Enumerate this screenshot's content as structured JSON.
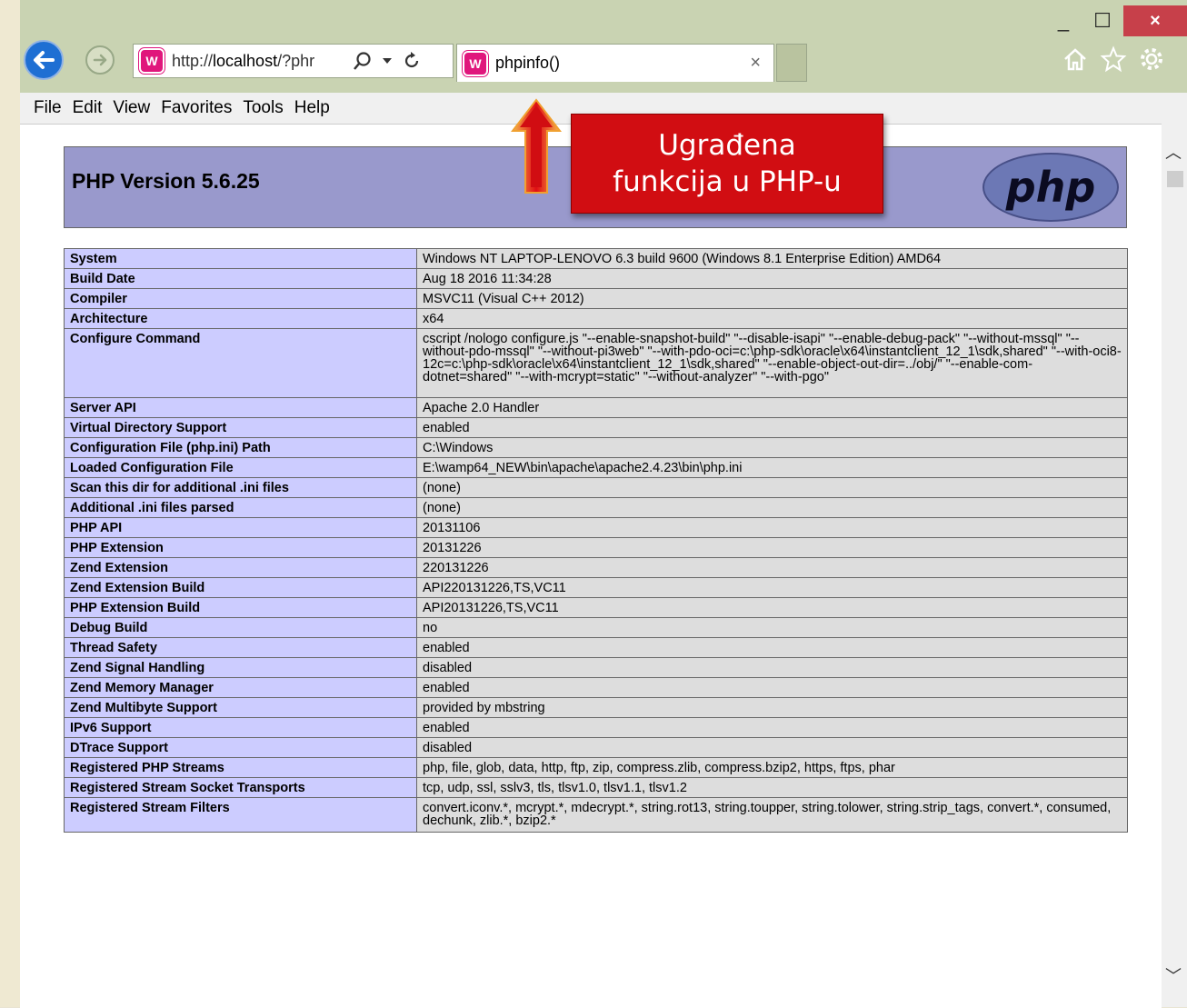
{
  "browser": {
    "address_prefix": "http://",
    "address_host": "localhost",
    "address_rest": "/?phr",
    "tab_title": "phpinfo()",
    "tab_close": "×",
    "window_min": "_",
    "window_max": "☐",
    "window_close": "×"
  },
  "menubar": {
    "items": [
      "File",
      "Edit",
      "View",
      "Favorites",
      "Tools",
      "Help"
    ]
  },
  "php": {
    "title": "PHP Version 5.6.25",
    "logo_text": "php",
    "rows": [
      {
        "key": "System",
        "value": "Windows NT LAPTOP-LENOVO 6.3 build 9600 (Windows 8.1 Enterprise Edition) AMD64"
      },
      {
        "key": "Build Date",
        "value": "Aug 18 2016 11:34:28"
      },
      {
        "key": "Compiler",
        "value": "MSVC11 (Visual C++ 2012)"
      },
      {
        "key": "Architecture",
        "value": "x64"
      },
      {
        "key": "Configure Command",
        "value": "cscript /nologo configure.js \"--enable-snapshot-build\" \"--disable-isapi\" \"--enable-debug-pack\" \"--without-mssql\" \"--without-pdo-mssql\" \"--without-pi3web\" \"--with-pdo-oci=c:\\php-sdk\\oracle\\x64\\instantclient_12_1\\sdk,shared\" \"--with-oci8-12c=c:\\php-sdk\\oracle\\x64\\instantclient_12_1\\sdk,shared\" \"--enable-object-out-dir=../obj/\" \"--enable-com-dotnet=shared\" \"--with-mcrypt=static\" \"--without-analyzer\" \"--with-pgo\""
      },
      {
        "key": "Server API",
        "value": "Apache 2.0 Handler"
      },
      {
        "key": "Virtual Directory Support",
        "value": "enabled"
      },
      {
        "key": "Configuration File (php.ini) Path",
        "value": "C:\\Windows"
      },
      {
        "key": "Loaded Configuration File",
        "value": "E:\\wamp64_NEW\\bin\\apache\\apache2.4.23\\bin\\php.ini"
      },
      {
        "key": "Scan this dir for additional .ini files",
        "value": "(none)"
      },
      {
        "key": "Additional .ini files parsed",
        "value": "(none)"
      },
      {
        "key": "PHP API",
        "value": "20131106"
      },
      {
        "key": "PHP Extension",
        "value": "20131226"
      },
      {
        "key": "Zend Extension",
        "value": "220131226"
      },
      {
        "key": "Zend Extension Build",
        "value": "API220131226,TS,VC11"
      },
      {
        "key": "PHP Extension Build",
        "value": "API20131226,TS,VC11"
      },
      {
        "key": "Debug Build",
        "value": "no"
      },
      {
        "key": "Thread Safety",
        "value": "enabled"
      },
      {
        "key": "Zend Signal Handling",
        "value": "disabled"
      },
      {
        "key": "Zend Memory Manager",
        "value": "enabled"
      },
      {
        "key": "Zend Multibyte Support",
        "value": "provided by mbstring"
      },
      {
        "key": "IPv6 Support",
        "value": "enabled"
      },
      {
        "key": "DTrace Support",
        "value": "disabled"
      },
      {
        "key": "Registered PHP Streams",
        "value": "php, file, glob, data, http, ftp, zip, compress.zlib, compress.bzip2, https, ftps, phar"
      },
      {
        "key": "Registered Stream Socket Transports",
        "value": "tcp, udp, ssl, sslv3, tls, tlsv1.0, tlsv1.1, tlsv1.2"
      },
      {
        "key": "Registered Stream Filters",
        "value": "convert.iconv.*, mcrypt.*, mdecrypt.*, string.rot13, string.toupper, string.tolower, string.strip_tags, convert.*, consumed, dechunk, zlib.*, bzip2.*"
      }
    ]
  },
  "annotation": {
    "line1": "Ugrađena",
    "line2": "funkcija u PHP-u"
  },
  "colors": {
    "callout": "#d10d12",
    "php_header": "#9999cc",
    "key_cell": "#ccccff",
    "value_cell": "#dddddd",
    "titlebar": "#c9d3b2"
  }
}
